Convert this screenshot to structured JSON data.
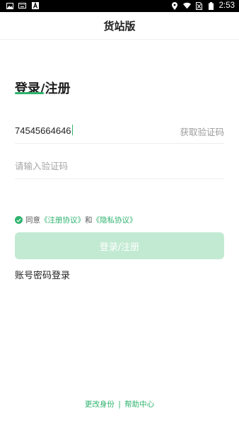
{
  "status_bar": {
    "time": "2:53",
    "left_icons": [
      "image-icon",
      "keyboard-icon",
      "text-a-icon"
    ],
    "right_icons": [
      "location-icon",
      "wifi-icon",
      "no-sim-icon",
      "battery-icon"
    ]
  },
  "app_bar": {
    "title": "货站版"
  },
  "login": {
    "heading": "登录/注册",
    "phone_value": "74545664646",
    "get_code_label": "获取验证码",
    "code_placeholder": "请输入验证码",
    "agreement": {
      "prefix": "同意",
      "register_link": "《注册协议》",
      "and": "和",
      "privacy_link": "《隐私协议》",
      "checked": true
    },
    "submit_label": "登录/注册",
    "password_login_label": "账号密码登录"
  },
  "footer": {
    "change_identity": "更改身份",
    "separator": "|",
    "help_center": "帮助中心"
  },
  "colors": {
    "accent": "#2eb36e",
    "button_disabled_bg": "#c2ead2"
  }
}
